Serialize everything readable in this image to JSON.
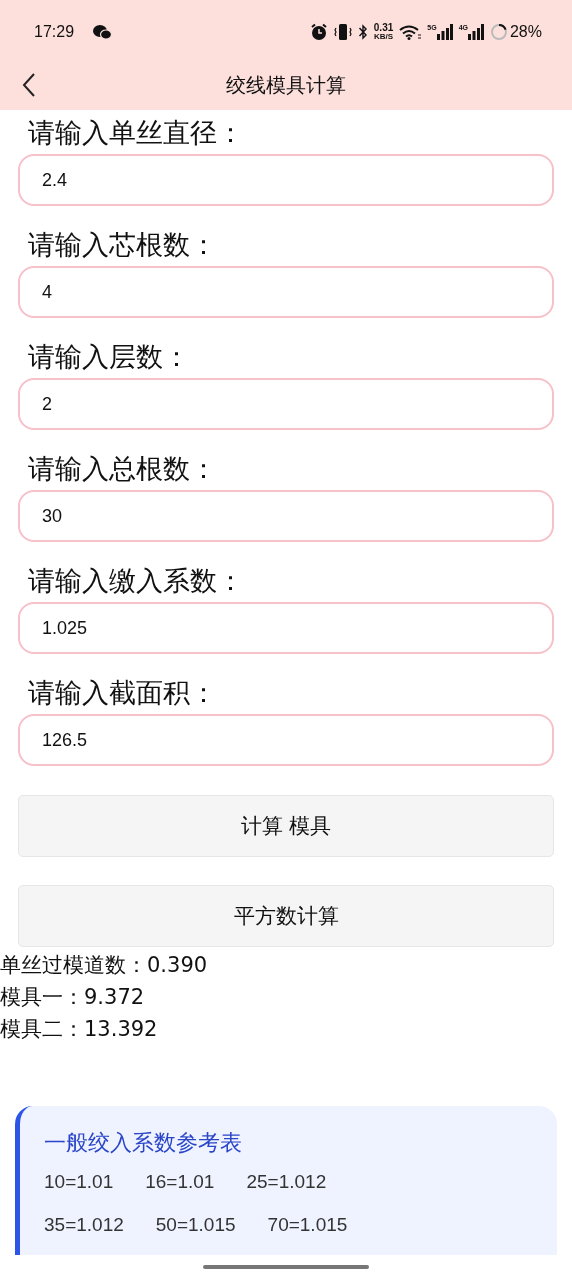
{
  "status_bar": {
    "time": "17:29",
    "network_speed": "0.31",
    "network_speed_unit": "KB/S",
    "signals": [
      {
        "label": "5G"
      },
      {
        "label": "4G"
      }
    ],
    "battery": "28%"
  },
  "header": {
    "title": "绞线模具计算"
  },
  "fields": [
    {
      "label": "请输入单丝直径：",
      "value": "2.4"
    },
    {
      "label": "请输入芯根数：",
      "value": "4"
    },
    {
      "label": "请输入层数：",
      "value": "2"
    },
    {
      "label": "请输入总根数：",
      "value": "30"
    },
    {
      "label": "请输入缴入系数：",
      "value": "1.025"
    },
    {
      "label": "请输入截面积：",
      "value": "126.5"
    }
  ],
  "buttons": [
    "计算 模具",
    "平方数计算"
  ],
  "results": [
    "单丝过模道数：0.390",
    "模具一：9.372",
    "模具二：13.392"
  ],
  "reference_card": {
    "title": "一般绞入系数参考表",
    "rows": [
      [
        "10=1.01",
        "16=1.01",
        "25=1.012"
      ],
      [
        "35=1.012",
        "50=1.015",
        "70=1.015"
      ]
    ]
  }
}
